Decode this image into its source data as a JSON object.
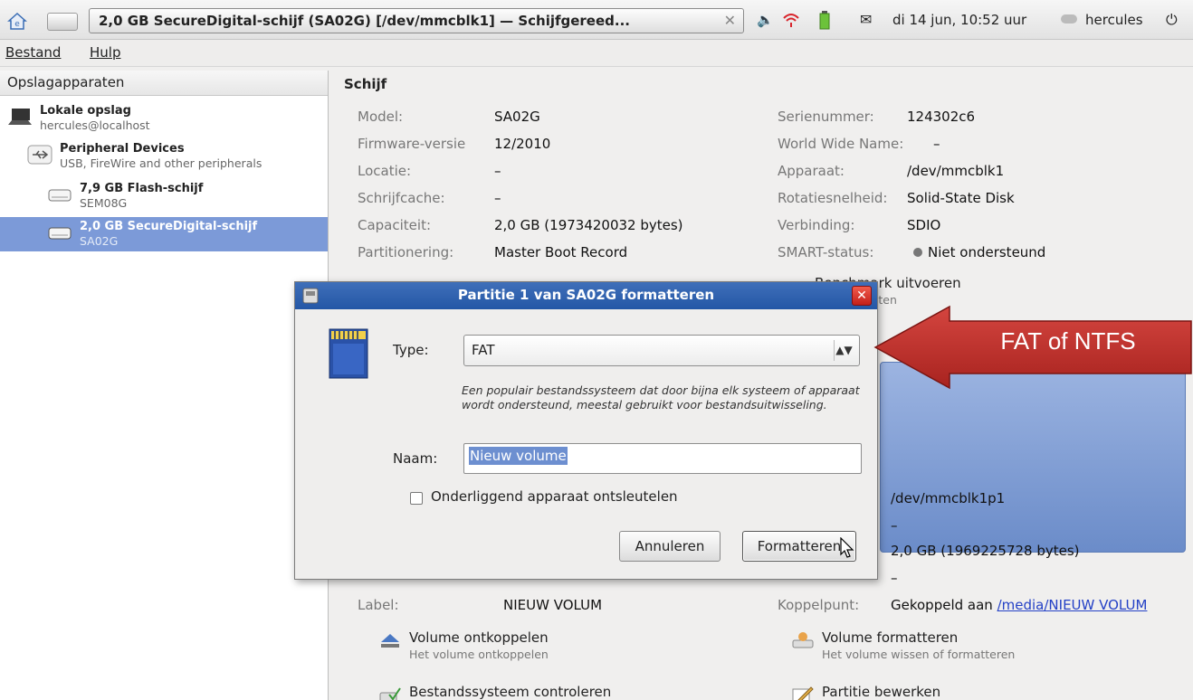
{
  "taskbar": {
    "window_title": "2,0 GB SecureDigital-schijf (SA02G) [/dev/mmcblk1] — Schijfgereed...",
    "datetime": "di 14 jun, 10:52 uur",
    "user": "hercules"
  },
  "menubar": {
    "file": "Bestand",
    "help": "Hulp"
  },
  "sidebar": {
    "header": "Opslagapparaten",
    "items": [
      {
        "name": "Lokale opslag",
        "sub": "hercules@localhost"
      },
      {
        "name": "Peripheral Devices",
        "sub": "USB, FireWire and other peripherals"
      },
      {
        "name": "7,9 GB Flash-schijf",
        "sub": "SEM08G"
      },
      {
        "name": "2,0 GB SecureDigital-schijf",
        "sub": "SA02G"
      }
    ]
  },
  "disk": {
    "title": "Schijf",
    "model_label": "Model:",
    "model": "SA02G",
    "firmware_label": "Firmware-versie",
    "firmware": "12/2010",
    "location_label": "Locatie:",
    "location": "–",
    "cache_label": "Schrijfcache:",
    "cache": "–",
    "capacity_label": "Capaciteit:",
    "capacity": "2,0 GB (1973420032 bytes)",
    "partitioning_label": "Partitionering:",
    "partitioning": "Master Boot Record",
    "serial_label": "Serienummer:",
    "serial": "124302c6",
    "wwn_label": "World Wide Name:",
    "wwn": "–",
    "device_label": "Apparaat:",
    "device": "/dev/mmcblk1",
    "rotation_label": "Rotatiesnelheid:",
    "rotation": "Solid-State Disk",
    "connection_label": "Verbinding:",
    "connection": "SDIO",
    "smart_label": "SMART-status:",
    "smart": "Niet ondersteund",
    "benchmark_label": "Benchmark uitvoeren",
    "benchmark_sub": "statties meten"
  },
  "volume": {
    "device": "/dev/mmcblk1p1",
    "dash": "–",
    "size": "2,0 GB (1969225728 bytes)",
    "dash2": "–",
    "label_label": "Label:",
    "label": "NIEUW VOLUM",
    "mount_label": "Koppelpunt:",
    "mount_prefix": "Gekoppeld aan",
    "mount_link": "/media/NIEUW VOLUM",
    "unmount_label": "Volume ontkoppelen",
    "unmount_sub": "Het volume ontkoppelen",
    "format_label": "Volume formatteren",
    "format_sub": "Het volume wissen of formatteren",
    "check_label": "Bestandssysteem controleren",
    "edit_label": "Partitie bewerken"
  },
  "dialog": {
    "title": "Partitie 1 van SA02G formatteren",
    "type_label": "Type:",
    "type_value": "FAT",
    "type_description": "Een populair bestandssysteem dat door bijna elk systeem of apparaat wordt ondersteund, meestal gebruikt voor bestandsuitwisseling.",
    "name_label": "Naam:",
    "name_value": "Nieuw volume",
    "checkbox_label": "Onderliggend apparaat ontsleutelen",
    "cancel": "Annuleren",
    "format": "Formatteren"
  },
  "annotation": {
    "text": "FAT of NTFS",
    "color": "#c0302c"
  }
}
